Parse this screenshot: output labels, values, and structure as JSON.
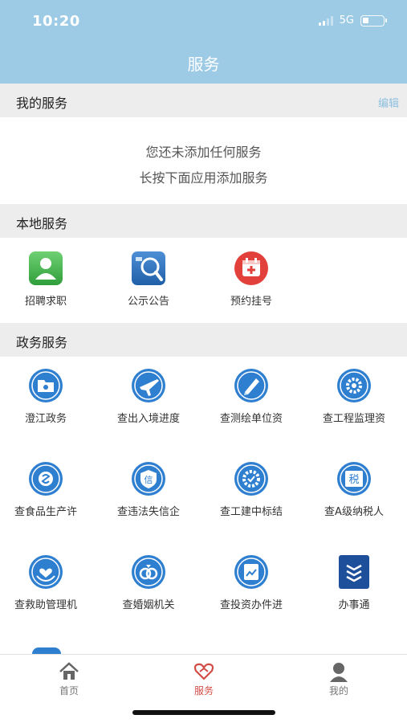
{
  "status": {
    "time": "10:20",
    "network": "5G"
  },
  "header": {
    "title": "服务"
  },
  "my_services": {
    "title": "我的服务",
    "edit_label": "编辑",
    "empty_line1": "您还未添加任何服务",
    "empty_line2": "长按下面应用添加服务"
  },
  "local_services": {
    "title": "本地服务",
    "items": [
      {
        "label": "招聘求职",
        "icon": "job-search-icon"
      },
      {
        "label": "公示公告",
        "icon": "announcement-icon"
      },
      {
        "label": "预约挂号",
        "icon": "appointment-icon"
      }
    ]
  },
  "gov_services": {
    "title": "政务服务",
    "items": [
      {
        "label": "澄江政务",
        "icon": "gov-folder-icon"
      },
      {
        "label": "查出入境进度",
        "icon": "airplane-icon"
      },
      {
        "label": "查测绘单位资",
        "icon": "survey-icon"
      },
      {
        "label": "查工程监理资",
        "icon": "engineering-icon"
      },
      {
        "label": "查食品生产许",
        "icon": "food-license-icon"
      },
      {
        "label": "查违法失信企",
        "icon": "credit-icon"
      },
      {
        "label": "查工建中标结",
        "icon": "bid-result-icon"
      },
      {
        "label": "查A级纳税人",
        "icon": "tax-icon"
      },
      {
        "label": "查救助管理机",
        "icon": "relief-icon"
      },
      {
        "label": "查婚姻机关",
        "icon": "marriage-icon"
      },
      {
        "label": "查投资办件进",
        "icon": "investment-icon"
      },
      {
        "label": "办事通",
        "icon": "banshitong-icon"
      }
    ]
  },
  "tab_icon_texts": {
    "credit": "信",
    "tax": "税"
  },
  "bottom_nav": {
    "items": [
      {
        "label": "首页",
        "icon": "home-icon"
      },
      {
        "label": "服务",
        "icon": "service-icon",
        "active": true
      },
      {
        "label": "我的",
        "icon": "profile-icon"
      }
    ]
  },
  "colors": {
    "header_bg": "#9dcbe6",
    "icon_blue": "#2f7fd0",
    "active_tab": "#d34b45",
    "section_bg": "#ededed"
  }
}
